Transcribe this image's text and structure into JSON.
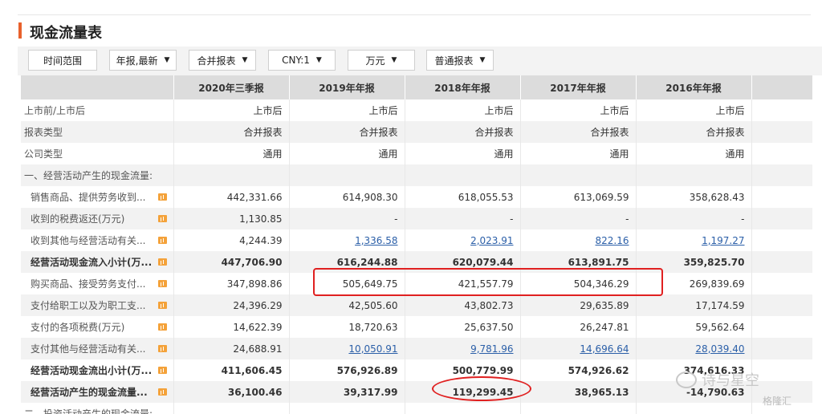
{
  "title": "现金流量表",
  "toolbar": {
    "time_range": "时间范围",
    "report_period": "年报,最新",
    "report_scope": "合并报表",
    "currency": "CNY:1",
    "unit": "万元",
    "report_type": "普通报表"
  },
  "columns": [
    "2020年三季报",
    "2019年年报",
    "2018年年报",
    "2017年年报",
    "2016年年报"
  ],
  "rows": [
    {
      "label": "上市前/上市后",
      "values": [
        "上市后",
        "上市后",
        "上市后",
        "上市后",
        "上市后"
      ]
    },
    {
      "label": "报表类型",
      "values": [
        "合并报表",
        "合并报表",
        "合并报表",
        "合并报表",
        "合并报表"
      ]
    },
    {
      "label": "公司类型",
      "values": [
        "通用",
        "通用",
        "通用",
        "通用",
        "通用"
      ]
    },
    {
      "label": "一、经营活动产生的现金流量:",
      "values": [
        "",
        "",
        "",
        "",
        ""
      ]
    },
    {
      "label": "销售商品、提供劳务收到...",
      "values": [
        "442,331.66",
        "614,908.30",
        "618,055.53",
        "613,069.59",
        "358,628.43"
      ]
    },
    {
      "label": "收到的税费返还(万元)",
      "values": [
        "1,130.85",
        "-",
        "-",
        "-",
        "-"
      ]
    },
    {
      "label": "收到其他与经营活动有关...",
      "values": [
        "4,244.39",
        "1,336.58",
        "2,023.91",
        "822.16",
        "1,197.27"
      ]
    },
    {
      "label": "经营活动现金流入小计(万...",
      "values": [
        "447,706.90",
        "616,244.88",
        "620,079.44",
        "613,891.75",
        "359,825.70"
      ]
    },
    {
      "label": "购买商品、接受劳务支付...",
      "values": [
        "347,898.86",
        "505,649.75",
        "421,557.79",
        "504,346.29",
        "269,839.69"
      ]
    },
    {
      "label": "支付给职工以及为职工支...",
      "values": [
        "24,396.29",
        "42,505.60",
        "43,802.73",
        "29,635.89",
        "17,174.59"
      ]
    },
    {
      "label": "支付的各项税费(万元)",
      "values": [
        "14,622.39",
        "18,720.63",
        "25,637.50",
        "26,247.81",
        "59,562.64"
      ]
    },
    {
      "label": "支付其他与经营活动有关...",
      "values": [
        "24,688.91",
        "10,050.91",
        "9,781.96",
        "14,696.64",
        "28,039.40"
      ]
    },
    {
      "label": "经营活动现金流出小计(万...",
      "values": [
        "411,606.45",
        "576,926.89",
        "500,779.99",
        "574,926.62",
        "374,616.33"
      ]
    },
    {
      "label": "经营活动产生的现金流量...",
      "values": [
        "36,100.46",
        "39,317.99",
        "119,299.45",
        "38,965.13",
        "-14,790.63"
      ]
    },
    {
      "label": "二、投资活动产生的现金流量:",
      "values": [
        "",
        "",
        "",
        "",
        ""
      ]
    }
  ],
  "watermark": {
    "text": "诗与星空",
    "source": "格隆汇"
  }
}
